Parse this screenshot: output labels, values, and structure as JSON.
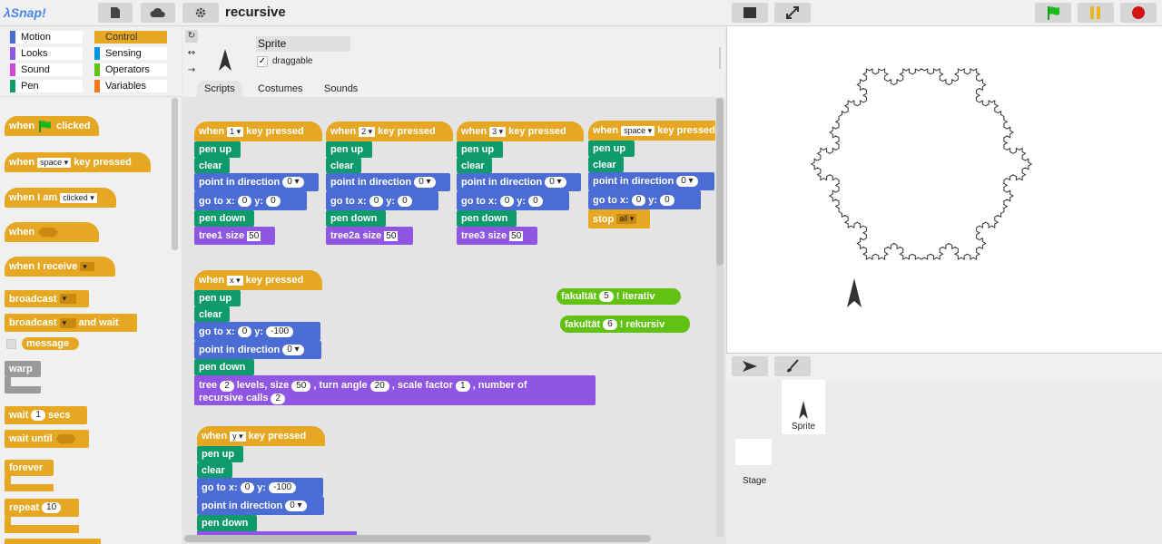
{
  "app": {
    "logo": "λSnap!",
    "project_title": "recursive"
  },
  "categories": [
    {
      "label": "Motion",
      "color": "#4a6cd4"
    },
    {
      "label": "Looks",
      "color": "#8f56e3"
    },
    {
      "label": "Sound",
      "color": "#cf4ad9"
    },
    {
      "label": "Pen",
      "color": "#0e9a6c"
    },
    {
      "label": "Control",
      "color": "#e6a822"
    },
    {
      "label": "Sensing",
      "color": "#0494dc"
    },
    {
      "label": "Operators",
      "color": "#62c213"
    },
    {
      "label": "Variables",
      "color": "#f3761d"
    }
  ],
  "palette": {
    "when_flag": {
      "pre": "when",
      "post": "clicked"
    },
    "when_key": {
      "pre": "when",
      "key": "space",
      "post": "key pressed"
    },
    "when_i_am": {
      "pre": "when I am",
      "opt": "clicked"
    },
    "when": "when",
    "when_receive": "when I receive",
    "broadcast": "broadcast",
    "broadcast_wait": {
      "pre": "broadcast",
      "post": "and wait"
    },
    "message": "message",
    "warp": "warp",
    "wait": {
      "pre": "wait",
      "val": "1",
      "post": "secs"
    },
    "wait_until": "wait until",
    "forever": "forever",
    "repeat": {
      "pre": "repeat",
      "val": "10"
    }
  },
  "sprite": {
    "name": "Sprite",
    "draggable": "draggable"
  },
  "tabs": [
    "Scripts",
    "Costumes",
    "Sounds"
  ],
  "scripts": {
    "when": "when",
    "key_pressed": "key pressed",
    "pen_up": "pen up",
    "clear": "clear",
    "point_in_direction": "point in direction",
    "go_to_x": "go to x:",
    "y": "y:",
    "pen_down": "pen down",
    "size": "size",
    "stop": "stop",
    "stop_opt": "all",
    "s1": {
      "key": "1",
      "dir": "0",
      "x": "0",
      "y": "0",
      "tree": "tree1",
      "size": "50"
    },
    "s2": {
      "key": "2",
      "dir": "0",
      "x": "0",
      "y": "0",
      "tree": "tree2a",
      "size": "50"
    },
    "s3": {
      "key": "3",
      "dir": "0",
      "x": "0",
      "y": "0",
      "tree": "tree3",
      "size": "50"
    },
    "s4": {
      "key": "space",
      "dir": "0",
      "x": "0",
      "y": "0"
    },
    "s5": {
      "key": "x",
      "x": "0",
      "y": "-100",
      "dir": "0"
    },
    "tree_block": {
      "t1": "tree",
      "levels": "2",
      "t2": "levels, size",
      "size": "50",
      "t3": ", turn angle",
      "angle": "20",
      "t4": ", scale factor",
      "factor": "1",
      "t5": ", number of",
      "t6": "recursive calls",
      "calls": "2"
    },
    "s6": {
      "key": "y",
      "x": "0",
      "y": "-100",
      "dir": "0"
    },
    "fak1": {
      "pre": "fakultät",
      "val": "5",
      "post": "! iterativ"
    },
    "fak2": {
      "pre": "fakultät",
      "val": "6",
      "post": "! rekursiv"
    }
  },
  "corral": {
    "sprite_label": "Sprite",
    "stage_label": "Stage"
  }
}
